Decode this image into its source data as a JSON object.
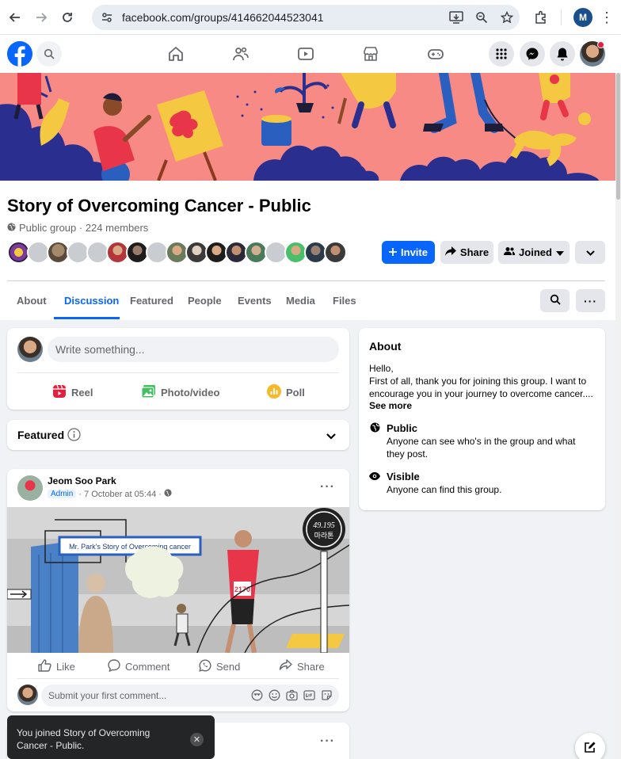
{
  "browser": {
    "url": "facebook.com/groups/414662044523041",
    "profile_initial": "M"
  },
  "group": {
    "title": "Story of Overcoming Cancer - Public",
    "meta": "Public group · 224 members",
    "invite_label": "Invite",
    "share_label": "Share",
    "joined_label": "Joined"
  },
  "tabs": [
    "About",
    "Discussion",
    "Featured",
    "People",
    "Events",
    "Media",
    "Files"
  ],
  "composer": {
    "placeholder": "Write something...",
    "reel": "Reel",
    "photo": "Photo/video",
    "poll": "Poll"
  },
  "featured": {
    "label": "Featured"
  },
  "about": {
    "title": "About",
    "text": "Hello,\nFirst of all, thank you for joining this group. I want to encourage you in your journey to overcome cancer....",
    "see_more": "See more",
    "public_title": "Public",
    "public_desc": "Anyone can see who's in the group and what they post.",
    "visible_title": "Visible",
    "visible_desc": "Anyone can find this group."
  },
  "post": {
    "author": "Jeom Soo Park",
    "badge": "Admin",
    "time": "· 7 October at 05:44 ·",
    "image_banner": "Mr. Park's Story of Overcoming cancer",
    "bib": "2170",
    "sign_top": "49.195",
    "sign_bottom": "마라톤",
    "like": "Like",
    "comment": "Comment",
    "send": "Send",
    "share": "Share",
    "comment_placeholder": "Submit your first comment..."
  },
  "toast": {
    "text": "You joined Story of Overcoming Cancer - Public."
  },
  "colors": {
    "fb_blue": "#0866ff",
    "cover_pink": "#f78a85",
    "cover_navy": "#2a2f8f"
  }
}
